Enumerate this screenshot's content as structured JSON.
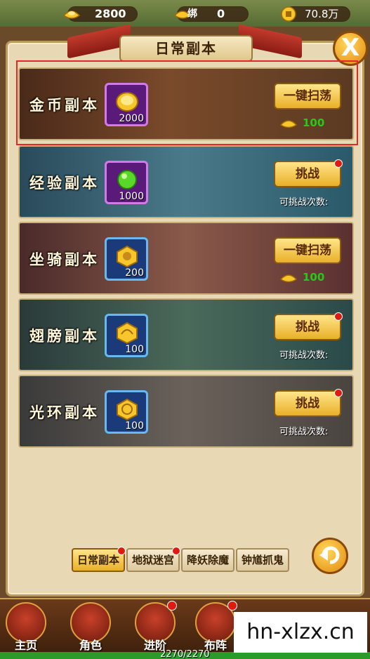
{
  "currency": {
    "ingot": "2800",
    "bound_label": "绑",
    "bound": "0",
    "coins": "70.8万"
  },
  "panel": {
    "title": "日常副本",
    "close_label": "X"
  },
  "dungeons": [
    {
      "name": "金币副本",
      "item_count": "2000",
      "button": "一键扫荡",
      "cost": "100",
      "attempts": ""
    },
    {
      "name": "经验副本",
      "item_count": "1000",
      "button": "挑战",
      "cost": "",
      "attempts": "可挑战次数:"
    },
    {
      "name": "坐骑副本",
      "item_count": "200",
      "button": "一键扫荡",
      "cost": "100",
      "attempts": ""
    },
    {
      "name": "翅膀副本",
      "item_count": "100",
      "button": "挑战",
      "cost": "",
      "attempts": "可挑战次数:"
    },
    {
      "name": "光环副本",
      "item_count": "100",
      "button": "挑战",
      "cost": "",
      "attempts": "可挑战次数:"
    }
  ],
  "tabs": [
    "日常副本",
    "地狱迷宫",
    "降妖除魔",
    "钟馗抓鬼"
  ],
  "nav": {
    "items": [
      "主页",
      "角色",
      "进阶",
      "布阵"
    ]
  },
  "hp": "2270/2270",
  "watermark": "hn-xlzx.cn",
  "colors": {
    "accent_gold": "#e9b028",
    "cost_green": "#2ac81a",
    "alert_red": "#e01a10",
    "selection_red": "#e02a2a"
  },
  "icons": [
    "gold-ingot-icon",
    "bound-ingot-icon",
    "copper-coin-icon",
    "close-icon",
    "back-arrow-icon"
  ]
}
